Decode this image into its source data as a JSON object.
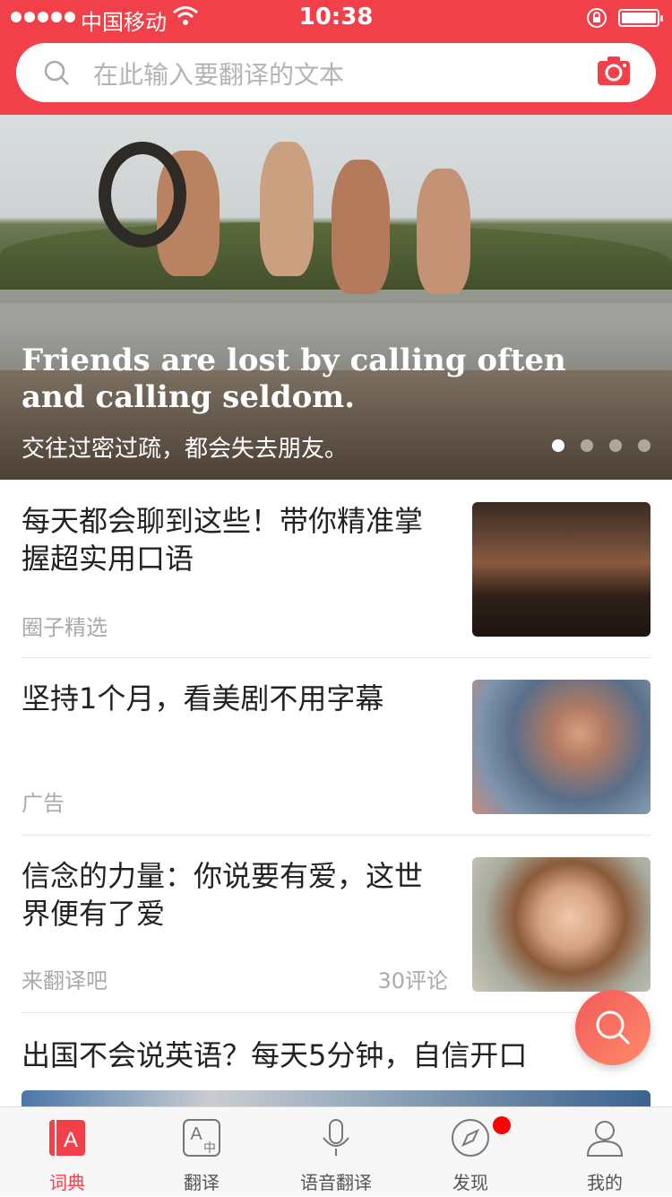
{
  "status_bar": {
    "carrier": "中国移动",
    "time": "10:38"
  },
  "search": {
    "placeholder": "在此输入要翻译的文本"
  },
  "banner": {
    "quote_en": "Friends are lost by calling often and calling seldom.",
    "quote_cn": "交往过密过疏，都会失去朋友。",
    "pages": 4,
    "active_page": 1
  },
  "feed": [
    {
      "title": "每天都会聊到这些！带你精准掌握超实用口语",
      "source": "圈子精选",
      "comments": ""
    },
    {
      "title": "坚持1个月，看美剧不用字幕",
      "source": "广告",
      "comments": ""
    },
    {
      "title": "信念的力量：你说要有爱，这世界便有了爱",
      "source": "来翻译吧",
      "comments": "30评论"
    },
    {
      "title": "出国不会说英语？每天5分钟，自信开口",
      "source": "",
      "comments": ""
    }
  ],
  "tabs": [
    {
      "label": "词典",
      "icon": "dictionary-icon",
      "active": true
    },
    {
      "label": "翻译",
      "icon": "translate-icon",
      "active": false
    },
    {
      "label": "语音翻译",
      "icon": "microphone-icon",
      "active": false
    },
    {
      "label": "发现",
      "icon": "compass-icon",
      "active": false,
      "badge": true
    },
    {
      "label": "我的",
      "icon": "profile-icon",
      "active": false
    }
  ],
  "colors": {
    "brand": "#f2404b",
    "badge": "#ff0000"
  }
}
